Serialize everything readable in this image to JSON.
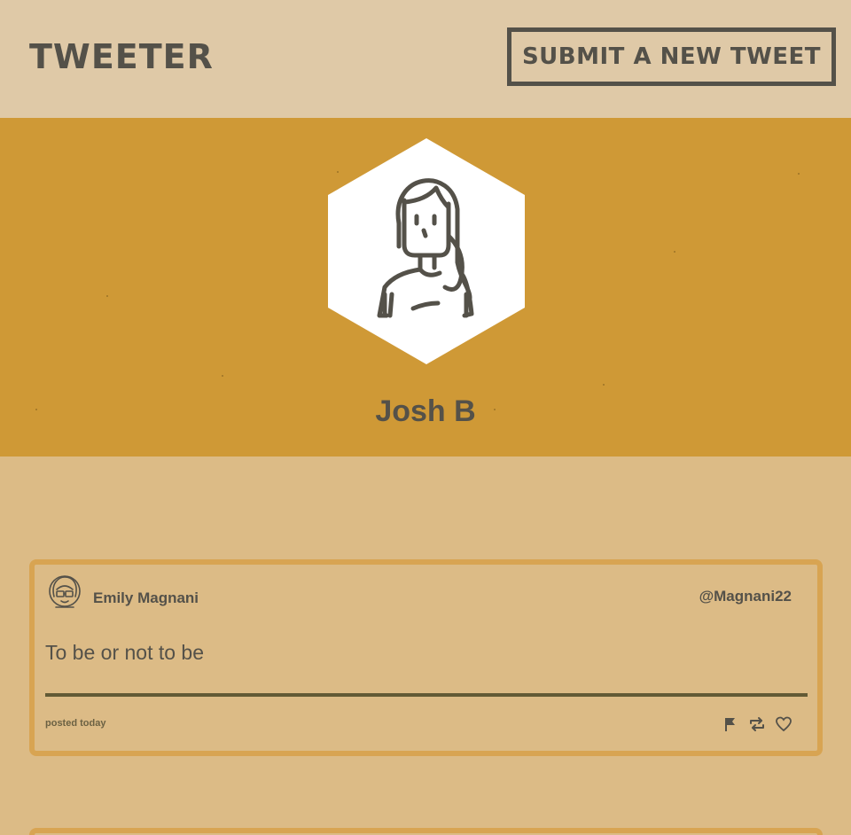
{
  "header": {
    "brand": "TWEETER",
    "compose_label": "SUBMIT A NEW TWEET"
  },
  "profile": {
    "name": "Josh B"
  },
  "tweets": [
    {
      "author_name": "Emily Magnani",
      "handle": "@Magnani22",
      "text": "To be or not to be",
      "posted": "posted today",
      "actions": [
        "flag-icon",
        "retweet-icon",
        "heart-icon"
      ]
    }
  ],
  "colors": {
    "header_bg": "#dfc9a7",
    "banner_bg": "#cf9936",
    "feed_bg": "#dcbb86",
    "card_border": "#d8a452",
    "ink": "#545149"
  }
}
